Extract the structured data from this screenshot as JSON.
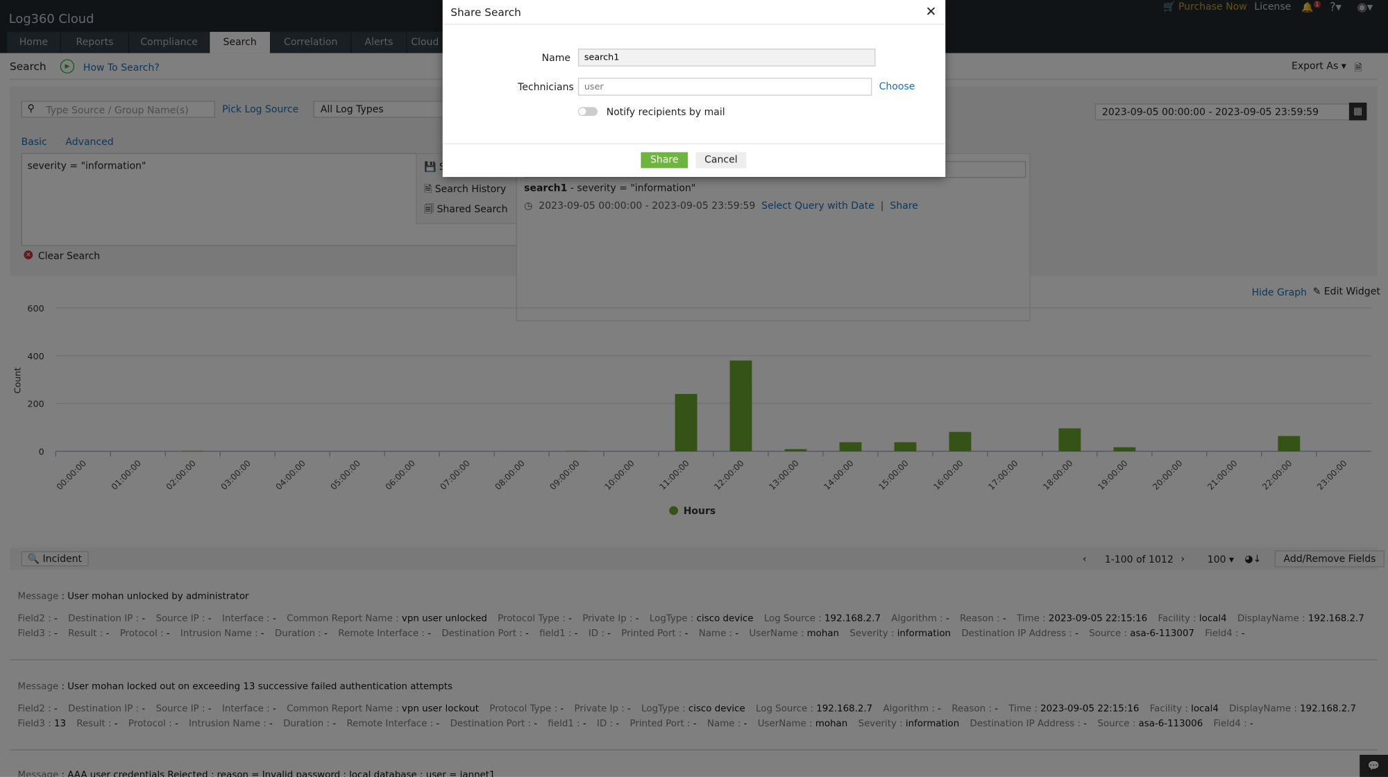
{
  "header": {
    "logo": "Log360 Cloud",
    "purchase": "Purchase Now",
    "license": "License",
    "notif_count": "1",
    "help": "?"
  },
  "tabs": [
    "Home",
    "Reports",
    "Compliance",
    "Search",
    "Correlation",
    "Alerts",
    "Cloud"
  ],
  "subheader": {
    "title": "Search",
    "how_to": "How To Search?",
    "export": "Export As"
  },
  "search": {
    "source_placeholder": "Type Source / Group Name(s)",
    "pick_source": "Pick Log Source",
    "log_types": "All Log Types",
    "date_range": "2023-09-05 00:00:00 - 2023-09-05 23:59:59",
    "tab_basic": "Basic",
    "tab_advanced": "Advanced",
    "query": "severity = \"information\"",
    "clear": "Clear Search"
  },
  "menu": {
    "items": [
      "S",
      "Search History",
      "Shared Search"
    ]
  },
  "saved": {
    "name": "search1",
    "query": " - severity = \"information\"",
    "date": "2023-09-05 00:00:00 - 2023-09-05 23:59:59",
    "select": "Select Query with Date",
    "share": "Share"
  },
  "graph": {
    "hide": "Hide Graph",
    "edit": "Edit Widget"
  },
  "chart_data": {
    "type": "bar",
    "ylabel": "Count",
    "ylim": [
      0,
      600
    ],
    "yticks": [
      0,
      200,
      400,
      600
    ],
    "legend": "Hours",
    "legend_position": "bottom",
    "color": "#6aa72e",
    "grid": true,
    "categories": [
      "00:00:00",
      "01:00:00",
      "02:00:00",
      "03:00:00",
      "04:00:00",
      "05:00:00",
      "06:00:00",
      "07:00:00",
      "08:00:00",
      "09:00:00",
      "10:00:00",
      "11:00:00",
      "12:00:00",
      "13:00:00",
      "14:00:00",
      "15:00:00",
      "16:00:00",
      "17:00:00",
      "18:00:00",
      "19:00:00",
      "20:00:00",
      "21:00:00",
      "22:00:00",
      "23:00:00"
    ],
    "values": [
      0,
      0,
      2,
      0,
      0,
      0,
      0,
      0,
      0,
      2,
      0,
      240,
      380,
      9,
      38,
      38,
      81,
      0,
      96,
      17,
      0,
      0,
      64,
      0
    ]
  },
  "results": {
    "incident": "Incident",
    "range": "1-100 of 1012",
    "per_page": "100",
    "add_remove": "Add/Remove Fields",
    "rows": [
      {
        "message": "User mohan unlocked by administrator",
        "line1": [
          [
            "Field2",
            "-"
          ],
          [
            "Destination IP",
            "-"
          ],
          [
            "Source IP",
            "-"
          ],
          [
            "Interface",
            "-"
          ],
          [
            "Common Report Name",
            "vpn user unlocked"
          ],
          [
            "Protocol Type",
            "-"
          ],
          [
            "Private Ip",
            "-"
          ],
          [
            "LogType",
            "cisco device"
          ],
          [
            "Log Source",
            "192.168.2.7"
          ],
          [
            "Algorithm",
            "-"
          ],
          [
            "Reason",
            "-"
          ],
          [
            "Time",
            "2023-09-05 22:15:16"
          ],
          [
            "Facility",
            "local4"
          ],
          [
            "DisplayName",
            "192.168.2.7"
          ]
        ],
        "line2": [
          [
            "Field3",
            "-"
          ],
          [
            "Result",
            "-"
          ],
          [
            "Protocol",
            "-"
          ],
          [
            "Intrusion Name",
            "-"
          ],
          [
            "Duration",
            "-"
          ],
          [
            "Remote Interface",
            "-"
          ],
          [
            "Destination Port",
            "-"
          ],
          [
            "field1",
            "-"
          ],
          [
            "ID",
            "-"
          ],
          [
            "Printed Port",
            "-"
          ],
          [
            "Name",
            "-"
          ],
          [
            "UserName",
            "mohan"
          ],
          [
            "Severity",
            "information"
          ],
          [
            "Destination IP Address",
            "-"
          ],
          [
            "Source",
            "asa-6-113007"
          ],
          [
            "Field4",
            "-"
          ]
        ]
      },
      {
        "message": "User mohan locked out on exceeding 13 successive failed authentication attempts",
        "line1": [
          [
            "Field2",
            "-"
          ],
          [
            "Destination IP",
            "-"
          ],
          [
            "Source IP",
            "-"
          ],
          [
            "Interface",
            "-"
          ],
          [
            "Common Report Name",
            "vpn user lockout"
          ],
          [
            "Protocol Type",
            "-"
          ],
          [
            "Private Ip",
            "-"
          ],
          [
            "LogType",
            "cisco device"
          ],
          [
            "Log Source",
            "192.168.2.7"
          ],
          [
            "Algorithm",
            "-"
          ],
          [
            "Reason",
            "-"
          ],
          [
            "Time",
            "2023-09-05 22:15:16"
          ],
          [
            "Facility",
            "local4"
          ],
          [
            "DisplayName",
            "192.168.2.7"
          ]
        ],
        "line2": [
          [
            "Field3",
            "13"
          ],
          [
            "Result",
            "-"
          ],
          [
            "Protocol",
            "-"
          ],
          [
            "Intrusion Name",
            "-"
          ],
          [
            "Duration",
            "-"
          ],
          [
            "Remote Interface",
            "-"
          ],
          [
            "Destination Port",
            "-"
          ],
          [
            "field1",
            "-"
          ],
          [
            "ID",
            "-"
          ],
          [
            "Printed Port",
            "-"
          ],
          [
            "Name",
            "-"
          ],
          [
            "UserName",
            "mohan"
          ],
          [
            "Severity",
            "information"
          ],
          [
            "Destination IP Address",
            "-"
          ],
          [
            "Source",
            "asa-6-113006"
          ],
          [
            "Field4",
            "-"
          ]
        ]
      },
      {
        "message": "AAA user credentials Rejected : reason = Invalid password : local database : user = jannet1"
      }
    ],
    "message_label": "Message"
  },
  "dialog": {
    "title": "Share Search",
    "name_label": "Name",
    "name_value": "search1",
    "tech_label": "Technicians",
    "tech_placeholder": "user",
    "choose": "Choose",
    "notify": "Notify recipients by mail",
    "notify_on": false,
    "share": "Share",
    "cancel": "Cancel"
  }
}
